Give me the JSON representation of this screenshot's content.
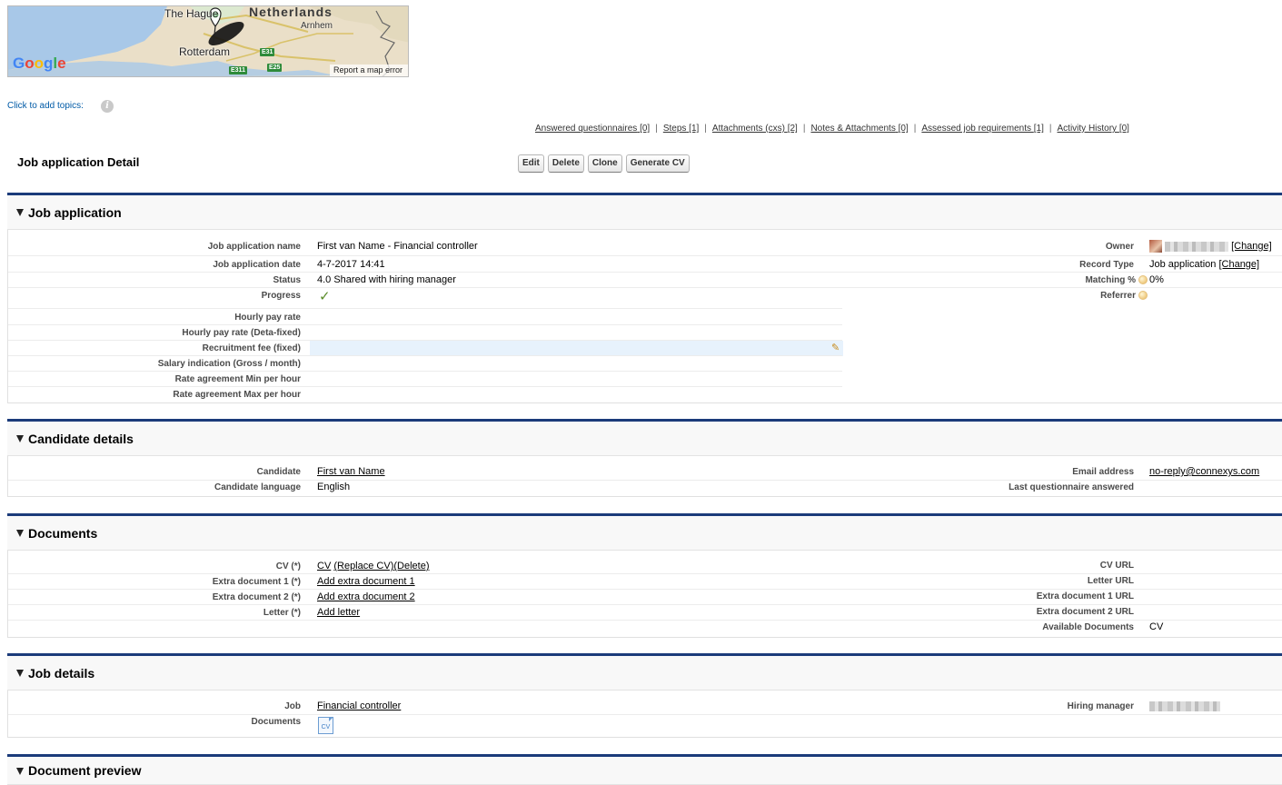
{
  "map": {
    "country_label": "Netherlands",
    "cities": [
      "The Hague",
      "Rotterdam",
      "Arnhem"
    ],
    "roads": [
      "E31",
      "E25",
      "E311"
    ],
    "provider": "Google",
    "report_link": "Report a map error",
    "colors": {
      "water": "#a8c8e8",
      "land": "#eadfc8",
      "road": "#2e8b3a"
    }
  },
  "topics": {
    "label": "Click to add topics:"
  },
  "related_links": [
    {
      "label": "Answered questionnaires",
      "count": "[0]"
    },
    {
      "label": "Steps",
      "count": "[1]"
    },
    {
      "label": "Attachments (cxs)",
      "count": "[2]"
    },
    {
      "label": "Notes & Attachments",
      "count": "[0]"
    },
    {
      "label": "Assessed job requirements",
      "count": "[1]"
    },
    {
      "label": "Activity History",
      "count": "[0]"
    }
  ],
  "related_separator": "|",
  "detail": {
    "title": "Job application Detail",
    "buttons": [
      "Edit",
      "Delete",
      "Clone",
      "Generate CV"
    ]
  },
  "sections": {
    "job_application": {
      "title": "Job application",
      "left": [
        {
          "label": "Job application name",
          "value": "First van Name - Financial controller"
        },
        {
          "label": "Job application date",
          "value": "4-7-2017 14:41"
        },
        {
          "label": "Status",
          "value": "4.0 Shared with hiring manager"
        },
        {
          "label": "Progress",
          "value": "✓"
        },
        {
          "label": "Hourly pay rate",
          "value": ""
        },
        {
          "label": "Hourly pay rate (Deta-fixed)",
          "value": ""
        },
        {
          "label": "Recruitment fee (fixed)",
          "value": ""
        },
        {
          "label": "Salary indication (Gross / month)",
          "value": ""
        },
        {
          "label": "Rate agreement Min per hour",
          "value": ""
        },
        {
          "label": "Rate agreement Max per hour",
          "value": ""
        }
      ],
      "right": [
        {
          "label": "Owner",
          "value": "",
          "link": "[Change]"
        },
        {
          "label": "Record Type",
          "value": "Job application",
          "link": "[Change]"
        },
        {
          "label": "Matching %",
          "value": "0%"
        },
        {
          "label": "Referrer",
          "value": ""
        }
      ]
    },
    "candidate": {
      "title": "Candidate details",
      "left": [
        {
          "label": "Candidate",
          "value": "First van Name"
        },
        {
          "label": "Candidate language",
          "value": "English"
        }
      ],
      "right": [
        {
          "label": "Email address",
          "value": "no-reply@connexys.com"
        },
        {
          "label": "Last questionnaire answered",
          "value": ""
        }
      ]
    },
    "documents": {
      "title": "Documents",
      "left": [
        {
          "label": "CV (*)",
          "links": [
            "CV",
            "(Replace CV)",
            "(Delete)"
          ]
        },
        {
          "label": "Extra document 1 (*)",
          "links": [
            "Add extra document 1"
          ]
        },
        {
          "label": "Extra document 2 (*)",
          "links": [
            "Add extra document 2"
          ]
        },
        {
          "label": "Letter (*)",
          "links": [
            "Add letter"
          ]
        }
      ],
      "right": [
        {
          "label": "CV URL",
          "value": ""
        },
        {
          "label": "Letter URL",
          "value": ""
        },
        {
          "label": "Extra document 1 URL",
          "value": ""
        },
        {
          "label": "Extra document 2 URL",
          "value": ""
        },
        {
          "label": "Available Documents",
          "value": "CV"
        }
      ]
    },
    "job_details": {
      "title": "Job details",
      "left": [
        {
          "label": "Job",
          "value": "Financial controller"
        },
        {
          "label": "Documents",
          "icon_text": "CV"
        }
      ],
      "right": [
        {
          "label": "Hiring manager",
          "value": ""
        }
      ]
    },
    "preview": {
      "title": "Document preview"
    }
  }
}
